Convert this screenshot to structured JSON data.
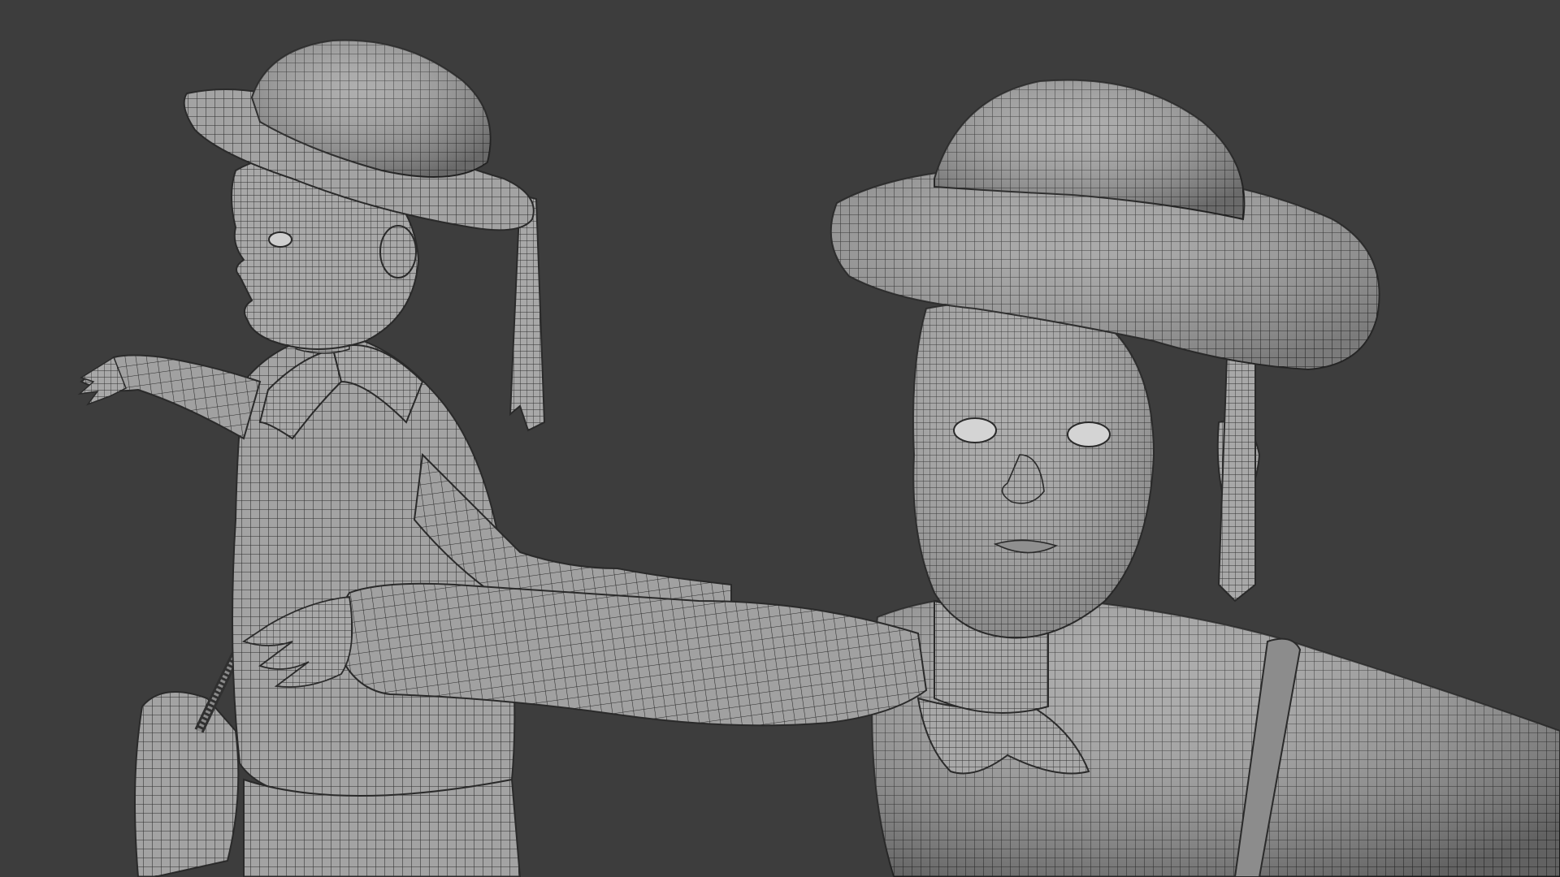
{
  "scene": {
    "background_color": "#3d3d3d",
    "mesh_fill_color": "#9a9a9a",
    "mesh_wire_color": "#2a2a2a",
    "models": [
      {
        "name": "character-side-view",
        "description_icon": "wireframe-mesh"
      },
      {
        "name": "character-front-view",
        "description_icon": "wireframe-mesh"
      }
    ]
  }
}
